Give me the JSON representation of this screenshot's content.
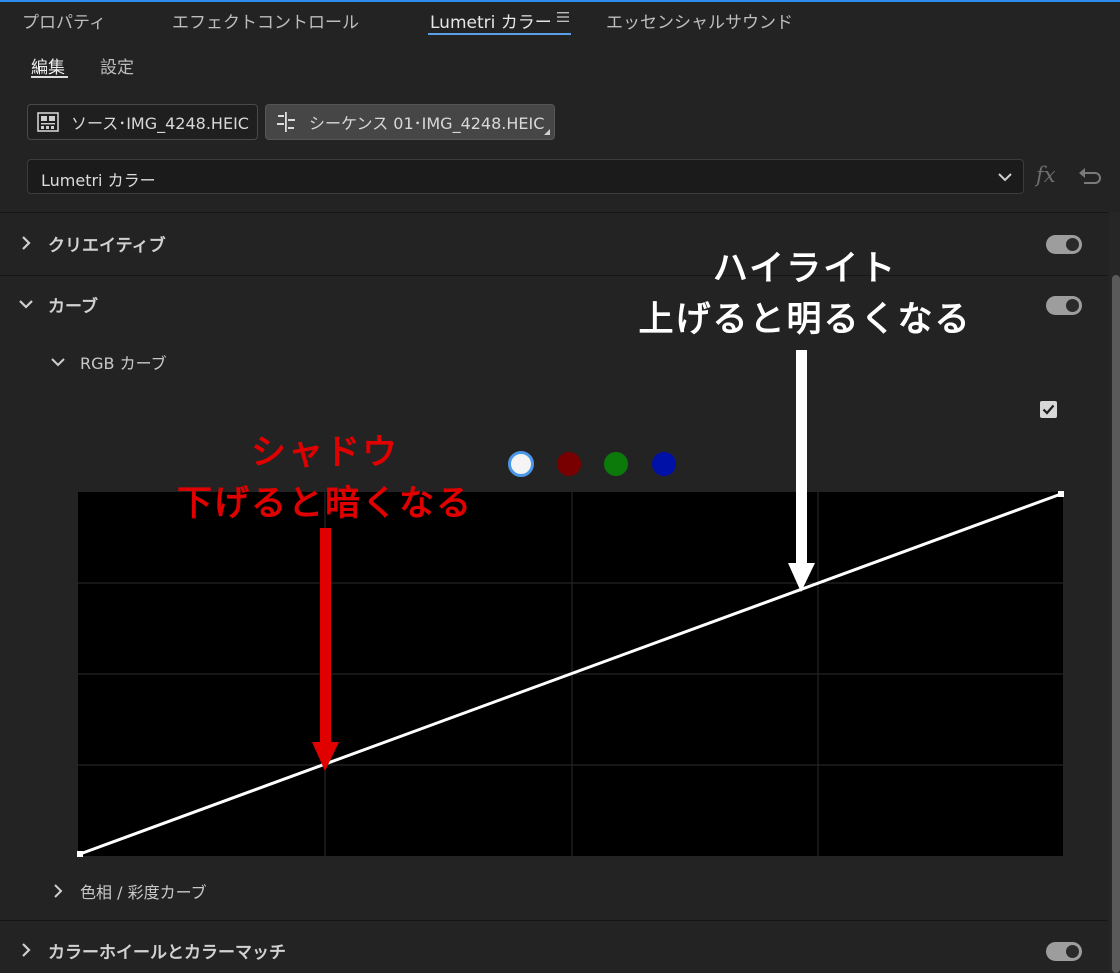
{
  "tabs": [
    {
      "label": "プロパティ"
    },
    {
      "label": "エフェクトコントロール"
    },
    {
      "label": "Lumetri カラー"
    },
    {
      "label": "エッセンシャルサウンド"
    }
  ],
  "subtabs": [
    {
      "label": "編集"
    },
    {
      "label": "設定"
    }
  ],
  "clips": {
    "source": "ソース･IMG_4248.HEIC",
    "sequence": "シーケンス 01･IMG_4248.HEIC"
  },
  "effect_dropdown": {
    "value": "Lumetri カラー"
  },
  "sections": {
    "creative": "クリエイティブ",
    "curves": "カーブ",
    "rgb_curve": "RGB カーブ",
    "hue_sat_curve": "色相 / 彩度カーブ",
    "color_wheels": "カラーホイールとカラーマッチ"
  },
  "channels": [
    {
      "name": "white",
      "color": "#f4f4f4",
      "selected": true
    },
    {
      "name": "red",
      "color": "#780000",
      "selected": false
    },
    {
      "name": "green",
      "color": "#0b7a0b",
      "selected": false
    },
    {
      "name": "blue",
      "color": "#0011a8",
      "selected": false
    }
  ],
  "annotations": {
    "highlight": {
      "line1": "ハイライト",
      "line2": "上げると明るくなる",
      "color": "#ffffff"
    },
    "shadow": {
      "line1": "シャドウ",
      "line2": "下げると暗くなる",
      "color": "#e00000"
    }
  },
  "colors": {
    "panel_bg": "#232323",
    "accent_blue": "#2d8ceb",
    "graph_bg": "#000000",
    "annotation_red": "#e00000"
  },
  "curve_enabled": true
}
